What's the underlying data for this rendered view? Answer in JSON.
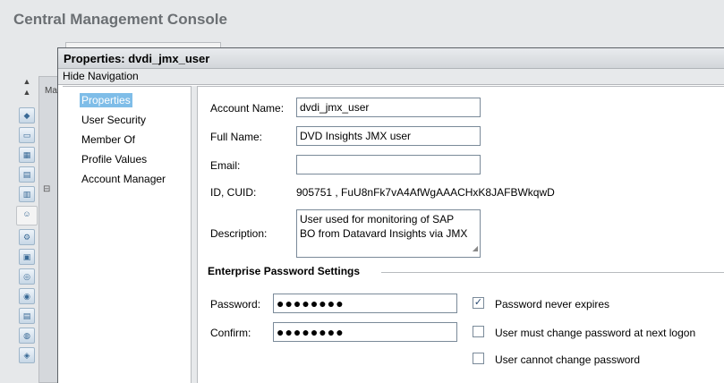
{
  "app": {
    "title": "Central Management Console"
  },
  "background": {
    "tab_label": "Ma"
  },
  "dialog": {
    "title": "Properties: dvdi_jmx_user",
    "hide_navigation": "Hide Navigation",
    "nav_items": [
      "Properties",
      "User Security",
      "Member Of",
      "Profile Values",
      "Account Manager"
    ],
    "selected_nav": "Properties"
  },
  "form": {
    "account_name": {
      "label": "Account Name:",
      "value": "dvdi_jmx_user"
    },
    "full_name": {
      "label": "Full Name:",
      "value": "DVD Insights JMX user"
    },
    "email": {
      "label": "Email:",
      "value": ""
    },
    "id_cuid": {
      "label": "ID, CUID:",
      "value": "905751 ,  FuU8nFk7vA4AfWgAAACHxK8JAFBWkqwD"
    },
    "description": {
      "label": "Description:",
      "line1": "User used for monitoring of SAP",
      "line2": "BO from Datavard Insights via JMX"
    },
    "password_section": "Enterprise Password Settings",
    "password": {
      "label": "Password:",
      "value": "●●●●●●●●"
    },
    "confirm": {
      "label": "Confirm:",
      "value": "●●●●●●●●"
    },
    "options": [
      {
        "label": "Password never expires",
        "checked": true
      },
      {
        "label": "User must change password at next logon",
        "checked": false
      },
      {
        "label": "User cannot change password",
        "checked": false
      }
    ]
  },
  "icons": {
    "checkmark": "✓",
    "arrow_up": "▲",
    "resize": "◢"
  }
}
